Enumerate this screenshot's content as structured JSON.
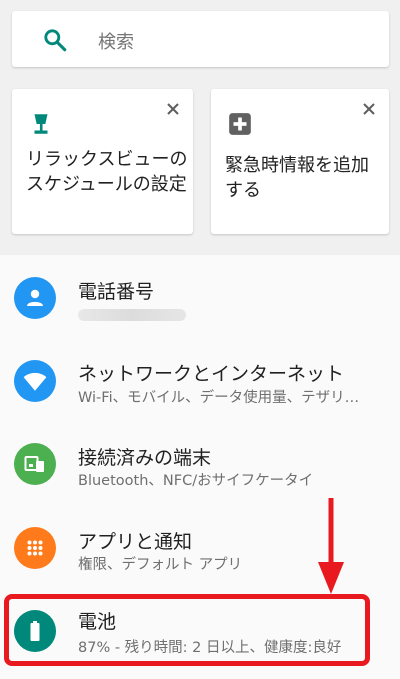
{
  "search": {
    "placeholder": "検索"
  },
  "suggestions": [
    {
      "text": "リラックスビューのスケジュールの設定",
      "icon": "lamp-icon"
    },
    {
      "text": "緊急時情報を追加する",
      "icon": "plus-box-icon"
    }
  ],
  "settings": [
    {
      "title": "電話番号",
      "subtitle": "",
      "icon": "person-icon",
      "color": "#2196f3"
    },
    {
      "title": "ネットワークとインターネット",
      "subtitle": "Wi-Fi、モバイル、データ使用量、テザリ…",
      "icon": "wifi-icon",
      "color": "#2196f3"
    },
    {
      "title": "接続済みの端末",
      "subtitle": "Bluetooth、NFC/おサイフケータイ",
      "icon": "devices-icon",
      "color": "#4caf50"
    },
    {
      "title": "アプリと通知",
      "subtitle": "権限、デフォルト アプリ",
      "icon": "apps-icon",
      "color": "#ff7a1a"
    },
    {
      "title": "電池",
      "subtitle": "87% - 残り時間: 2 日以上、健康度:良好",
      "icon": "battery-icon",
      "color": "#00897b"
    }
  ],
  "colors": {
    "accent": "#00897b",
    "highlight": "#e8191f"
  }
}
